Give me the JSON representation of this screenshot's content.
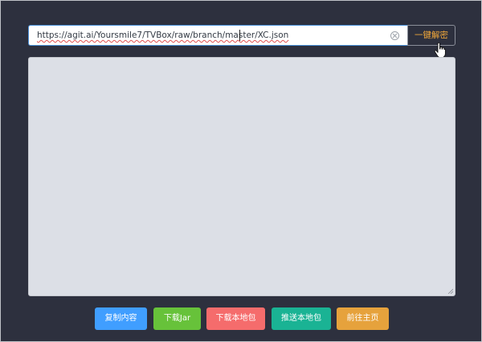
{
  "url_input": {
    "value": "https://agit.ai/Yoursmile7/TVBox/raw/branch/master/XC.json"
  },
  "decrypt_button": {
    "label": "一键解密"
  },
  "output": {
    "value": ""
  },
  "actions": {
    "copy": "复制内容",
    "download_jar": "下载Jar",
    "download_local": "下载本地包",
    "push_local": "推送本地包",
    "home": "前往主页"
  },
  "colors": {
    "background": "#2d303e",
    "accent_text": "#f0a73a",
    "copy": "#409eff",
    "download_jar": "#67c23a",
    "download_local": "#f56c6c",
    "push_local": "#1ab394",
    "home": "#e6a23c"
  }
}
